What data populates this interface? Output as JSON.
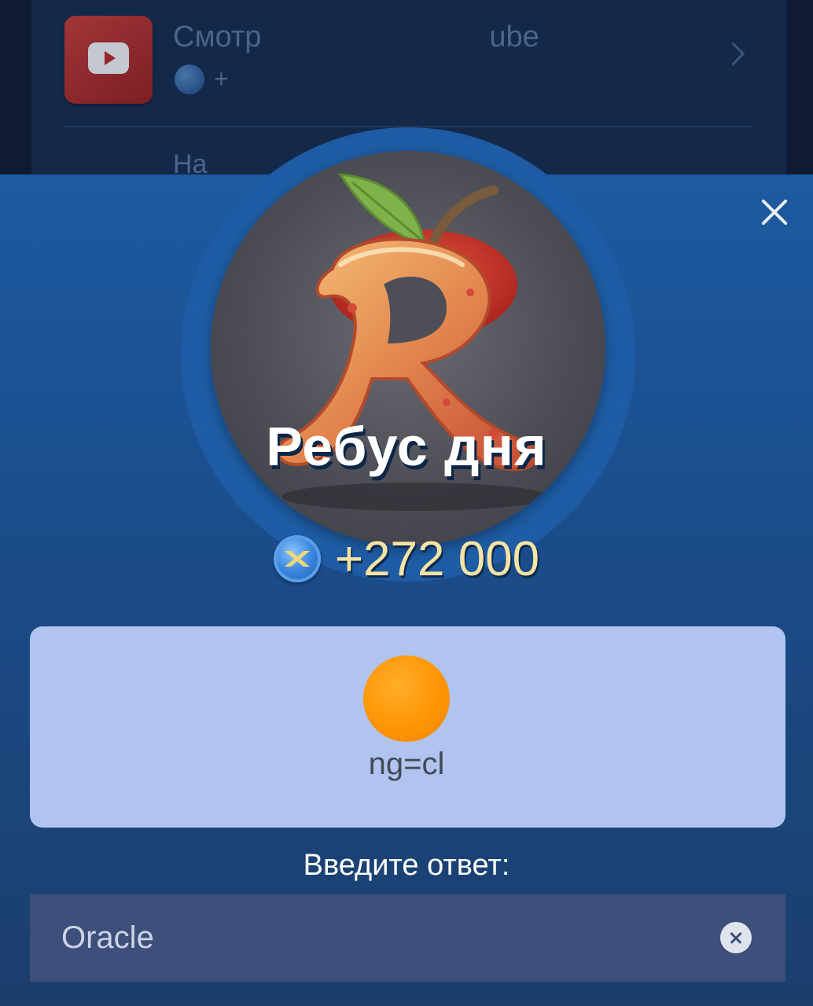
{
  "background_list": {
    "item1_title": "Смотр",
    "item1_title_end": "ube",
    "item1_reward": "+",
    "item2_title": "На"
  },
  "dialog": {
    "avatar_icon": "apple-letter-r-icon",
    "title": "Ребус дня",
    "reward_amount": "+272 000",
    "reward_icon": "coin-icon",
    "puzzle_icon": "orange-circle-icon",
    "puzzle_hint": "ng=cl",
    "answer_label": "Введите ответ:",
    "answer_value": "Oracle",
    "close_icon": "close-icon",
    "clear_icon": "clear-input-icon"
  },
  "colors": {
    "sheet_top": "#1d5aa0",
    "sheet_bottom": "#1b3e6c",
    "reward_text": "#f6e4a6",
    "puzzle_card_bg": "#b1c4f0",
    "orange": "#ff9505",
    "answer_field_bg": "#3d4f7a"
  }
}
